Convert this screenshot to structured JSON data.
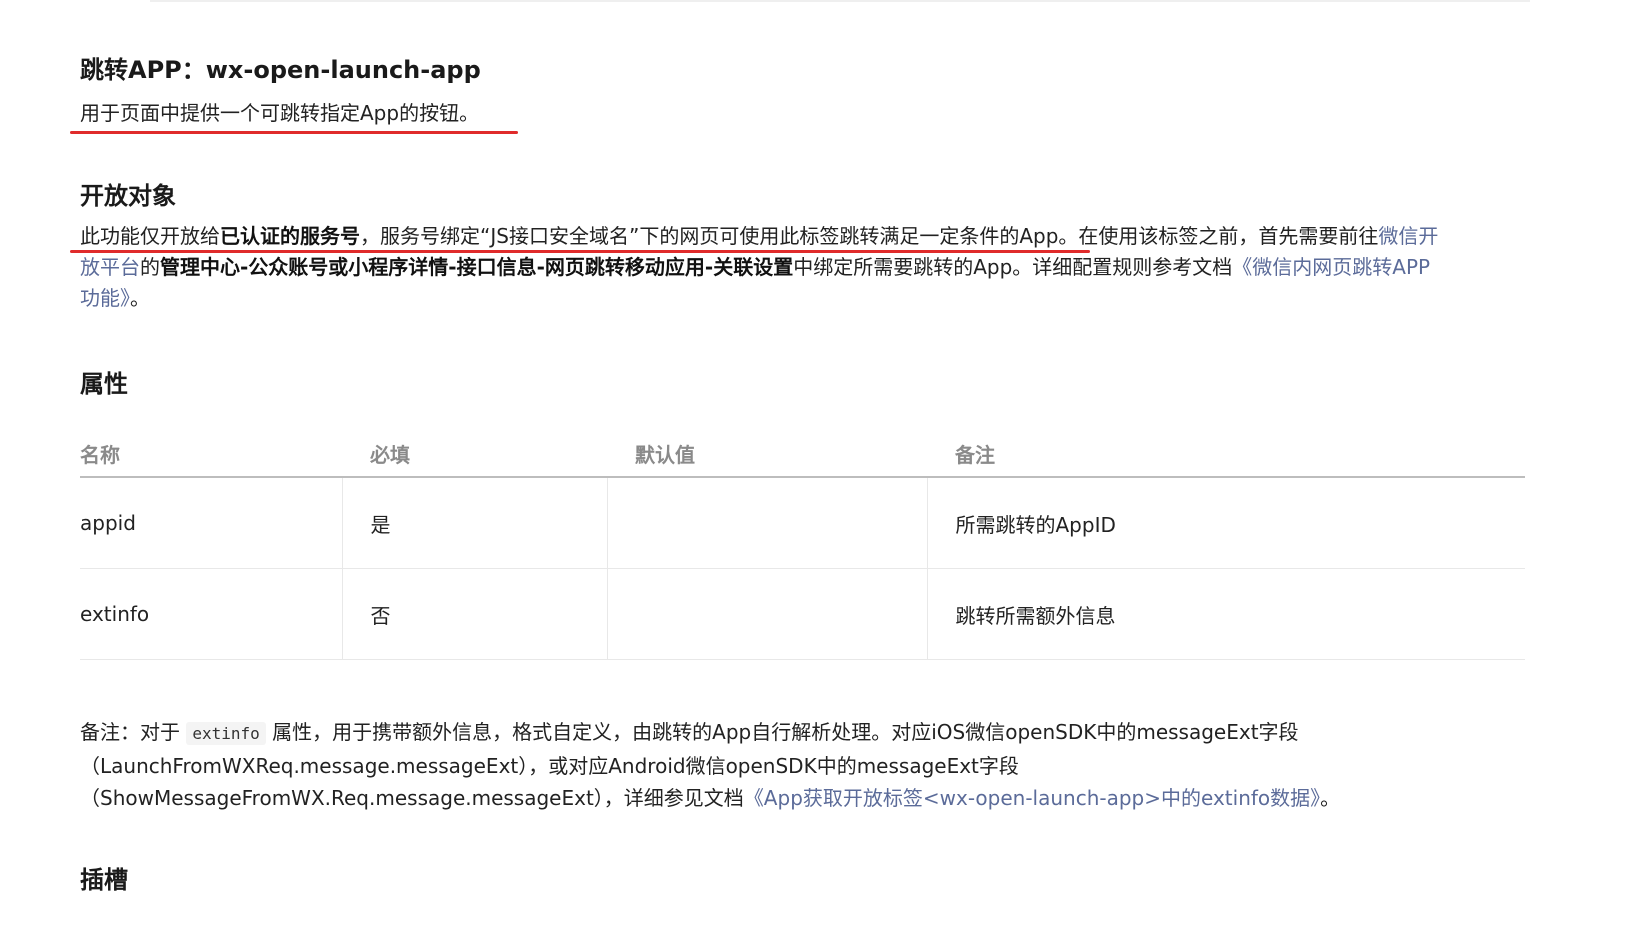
{
  "section_launch": {
    "title": "跳转APP：wx-open-launch-app",
    "desc": "用于页面中提供一个可跳转指定App的按钮。"
  },
  "section_audience": {
    "title": "开放对象",
    "p1": "此功能仅开放给",
    "p1_bold": "已认证的服务号",
    "p2": "，服务号绑定“JS接口安全域名”下的网页可使用此标签跳转满足一定条件的App。在使用该标签之前，首先需要前往",
    "link1_part1": "微信开",
    "link1_part2": "放平台",
    "p3": "的",
    "p3_bold": "管理中心-公众账号或小程序详情-接口信息-网页跳转移动应用-关联设置",
    "p4": "中绑定所需要跳转的App。详细配置规则参考文档",
    "link2_part1": "《微信内网页跳转APP",
    "link2_part2": "功能》",
    "p5": "。"
  },
  "section_attributes": {
    "title": "属性",
    "columns": [
      "名称",
      "必填",
      "默认值",
      "备注"
    ],
    "rows": [
      {
        "name": "appid",
        "required": "是",
        "default": "",
        "note": "所需跳转的AppID"
      },
      {
        "name": "extinfo",
        "required": "否",
        "default": "",
        "note": "跳转所需额外信息"
      }
    ]
  },
  "note": {
    "prefix": "备注：对于 ",
    "code": "extinfo",
    "line1": " 属性，用于携带额外信息，格式自定义，由跳转的App自行解析处理。对应iOS微信openSDK中的messageExt字段",
    "line2": "（LaunchFromWXReq.message.messageExt），或对应Android微信openSDK中的messageExt字段",
    "line3": "（ShowMessageFromWX.Req.message.messageExt），详细参见文档",
    "link": "《App获取开放标签<wx-open-launch-app>中的extinfo数据》",
    "end": "。"
  },
  "section_slots": {
    "title": "插槽"
  },
  "colors": {
    "link": "#5b6b99",
    "annotation_red": "#e02b2b",
    "header_gray": "#8a8a8a"
  }
}
